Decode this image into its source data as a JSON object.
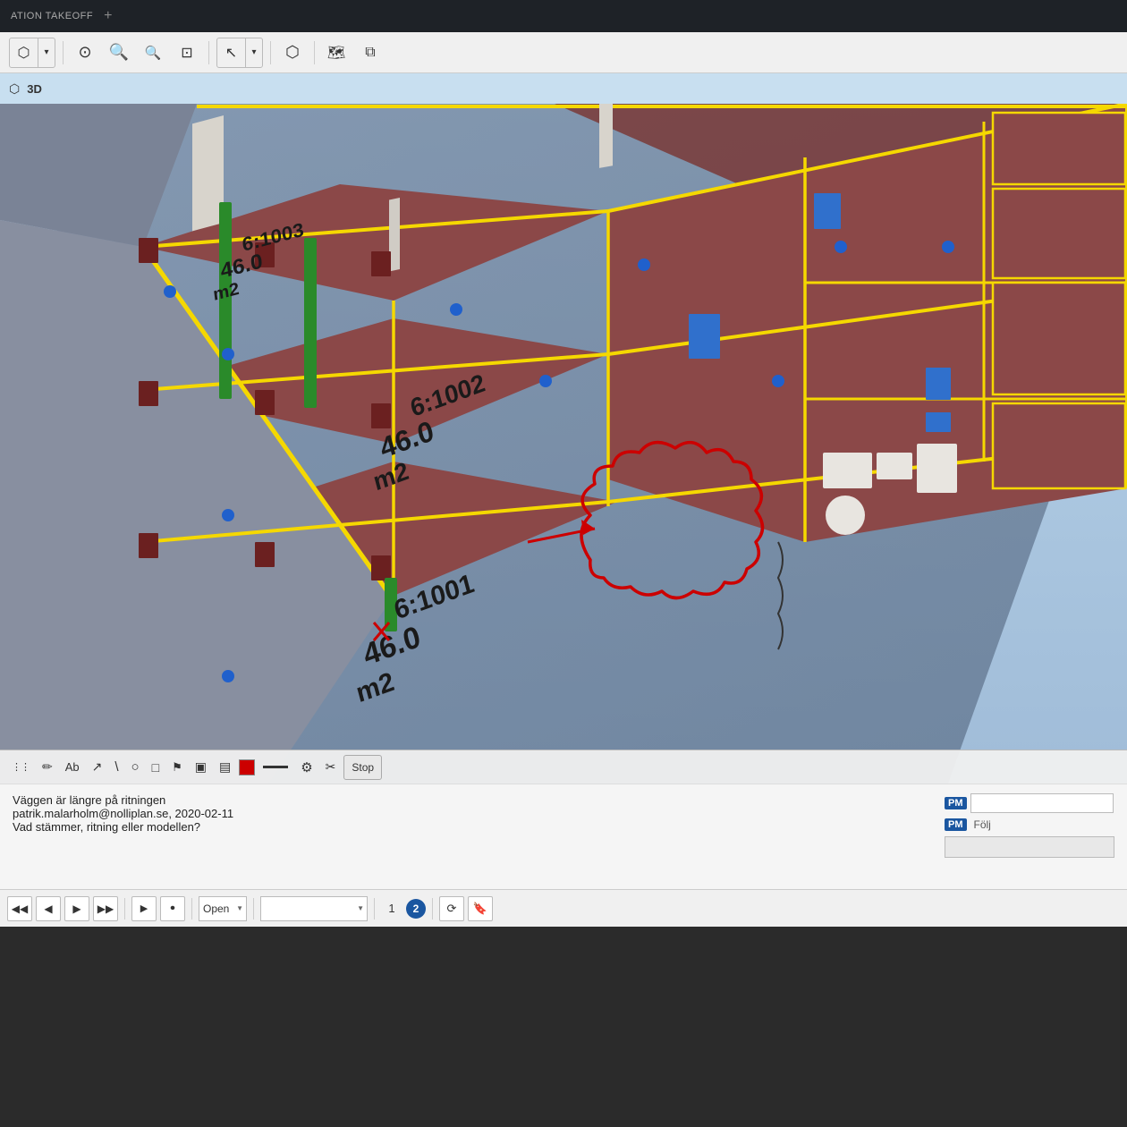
{
  "titlebar": {
    "app_name": "ATION TAKEOFF",
    "tab_add_label": "+"
  },
  "toolbar": {
    "tools": [
      {
        "name": "3d-view-icon",
        "symbol": "⬡",
        "label": "3D View"
      },
      {
        "name": "dropdown-arrow",
        "symbol": "▾",
        "label": "dropdown"
      },
      {
        "name": "zoom-fit-icon",
        "symbol": "⊙",
        "label": "Zoom Fit"
      },
      {
        "name": "zoom-in-icon",
        "symbol": "🔍",
        "label": "Zoom In"
      },
      {
        "name": "zoom-out-icon",
        "symbol": "🔍",
        "label": "Zoom Out"
      },
      {
        "name": "zoom-window-icon",
        "symbol": "⊡",
        "label": "Zoom Window"
      },
      {
        "name": "select-icon",
        "symbol": "↖",
        "label": "Select"
      },
      {
        "name": "select-dropdown",
        "symbol": "▾",
        "label": "dropdown"
      },
      {
        "name": "measure-icon",
        "symbol": "⬡",
        "label": "Measure"
      },
      {
        "name": "map-icon",
        "symbol": "🗺",
        "label": "Map"
      },
      {
        "name": "layers-icon",
        "symbol": "⧉",
        "label": "Layers"
      }
    ]
  },
  "view_label": {
    "icon": "⬡",
    "text": "3D"
  },
  "viewport": {
    "annotation_text": {
      "room1_id": "6:1003",
      "room1_area": "46.0",
      "room1_unit": "m2",
      "room2_id": "6:1002",
      "room2_area": "46.0",
      "room2_unit": "m2",
      "room3_id": "6:1001",
      "room3_area": "46.0",
      "room3_unit": "m2"
    }
  },
  "annotation_toolbar": {
    "tools": [
      {
        "name": "grid-icon",
        "symbol": "⋮⋮",
        "label": "Grid"
      },
      {
        "name": "pencil-icon",
        "symbol": "✏",
        "label": "Draw"
      },
      {
        "name": "text-icon",
        "symbol": "Ab",
        "label": "Text"
      },
      {
        "name": "arrow-icon",
        "symbol": "↗",
        "label": "Arrow"
      },
      {
        "name": "line-icon",
        "symbol": "\\",
        "label": "Line"
      },
      {
        "name": "ellipse-icon",
        "symbol": "○",
        "label": "Ellipse"
      },
      {
        "name": "rect-icon",
        "symbol": "□",
        "label": "Rectangle"
      },
      {
        "name": "stamp-icon",
        "symbol": "⚑",
        "label": "Stamp"
      },
      {
        "name": "image1-icon",
        "symbol": "▣",
        "label": "Image1"
      },
      {
        "name": "image2-icon",
        "symbol": "▤",
        "label": "Image2"
      },
      {
        "name": "color-red",
        "symbol": "",
        "label": "Red color",
        "color": "#cc0000"
      },
      {
        "name": "line-style",
        "symbol": "—",
        "label": "Line style"
      },
      {
        "name": "settings-icon",
        "symbol": "⚙",
        "label": "Settings"
      },
      {
        "name": "scissors-icon",
        "symbol": "✂",
        "label": "Scissors"
      },
      {
        "name": "stop-btn",
        "symbol": "Stop",
        "label": "Stop"
      }
    ]
  },
  "info_panel": {
    "title": "Väggen är längre på ritningen",
    "meta": "patrik.malarholm@nolliplan.se, 2020-02-11",
    "body": "Vad stämmer, ritning eller modellen?",
    "pm_badges": [
      {
        "box": "PM",
        "label": ""
      },
      {
        "box": "PM",
        "label": "Följ"
      }
    ],
    "pm_input_placeholder": ""
  },
  "nav_bar": {
    "page_current": "1",
    "page_active": "2",
    "open_label": "Open",
    "buttons": [
      {
        "name": "nav-first",
        "symbol": "◀◀"
      },
      {
        "name": "nav-prev",
        "symbol": "◀"
      },
      {
        "name": "nav-next",
        "symbol": "▶"
      },
      {
        "name": "nav-last",
        "symbol": "▶▶"
      },
      {
        "name": "nav-play",
        "symbol": "▶"
      },
      {
        "name": "nav-record",
        "symbol": "⏺"
      }
    ]
  },
  "colors": {
    "titlebar_bg": "#1e2227",
    "toolbar_bg": "#f0f0f0",
    "view_label_bg": "#c8dff0",
    "viewport_bg": "#7a8da8",
    "yellow_outline": "#f5d800",
    "red_annotation": "#cc0000",
    "floor_color": "#8b4a4a",
    "wall_color": "#d0cec8",
    "pm_blue": "#1a56a0",
    "accent_blue": "#1a56a0"
  }
}
